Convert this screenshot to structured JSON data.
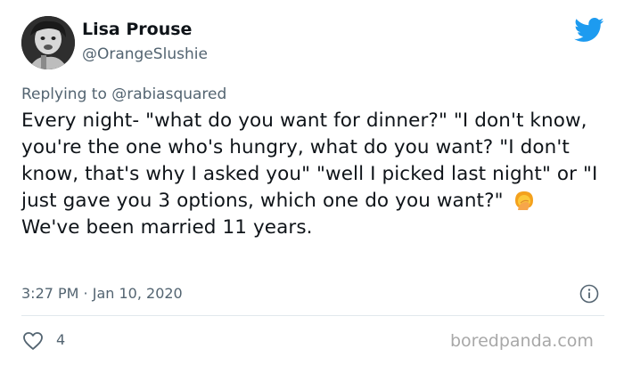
{
  "user": {
    "display_name": "Lisa Prouse",
    "handle": "@OrangeSlushie",
    "avatar_icon": "avatar-photo"
  },
  "tweet": {
    "reply_prefix": "Replying to ",
    "reply_handle": "@rabiasquared",
    "text_before_emoji": "Every night- \"what do you want for dinner?\" \"I don't know, you're the one who's hungry, what do you want? \"I don't know, that's why I asked you\" \"well I picked last night\" or \"I just gave you 3 options, which one do you want?\"",
    "emoji_name": "facepalm-emoji",
    "text_after_emoji": " We've been married 11 years.",
    "timestamp": "3:27 PM · Jan 10, 2020",
    "like_count": "4"
  },
  "brand": {
    "logo_icon": "twitter-bird-icon",
    "accent_color": "#1d9bf0",
    "watermark": "boredpanda.com"
  }
}
